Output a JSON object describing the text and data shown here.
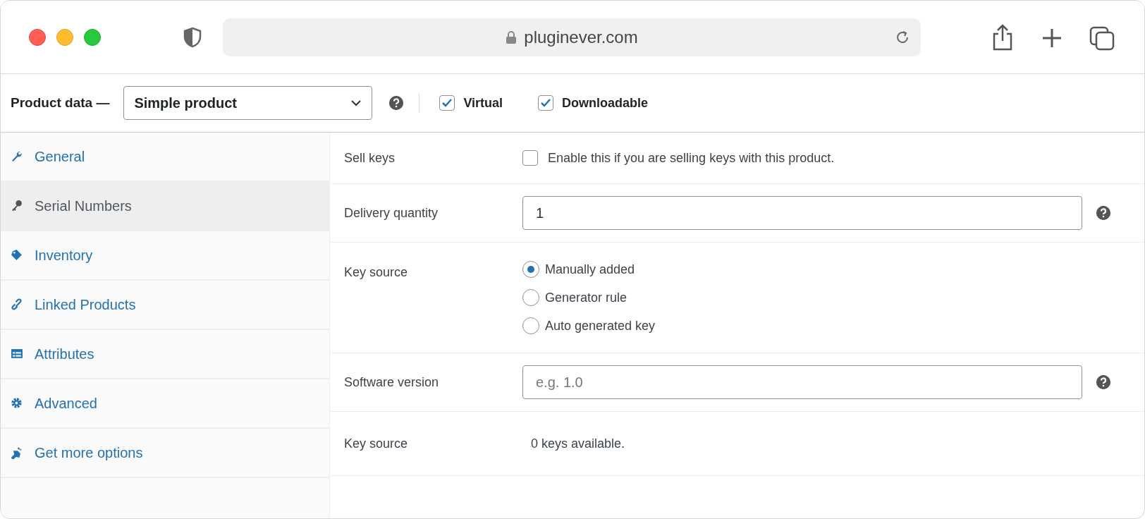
{
  "browser": {
    "url": "pluginever.com"
  },
  "product_data": {
    "label": "Product data —",
    "type_select": "Simple product",
    "options": [
      {
        "label": "Virtual",
        "checked": true
      },
      {
        "label": "Downloadable",
        "checked": true
      }
    ]
  },
  "sidebar": {
    "items": [
      {
        "label": "General",
        "kind": "wrench",
        "selected": false
      },
      {
        "label": "Serial Numbers",
        "kind": "key",
        "selected": true
      },
      {
        "label": "Inventory",
        "kind": "tag",
        "selected": false
      },
      {
        "label": "Linked Products",
        "kind": "link",
        "selected": false
      },
      {
        "label": "Attributes",
        "kind": "table",
        "selected": false
      },
      {
        "label": "Advanced",
        "kind": "gear",
        "selected": false
      },
      {
        "label": "Get more options",
        "kind": "plug",
        "selected": false
      }
    ]
  },
  "fields": [
    {
      "kind": "checkbox",
      "label": "Sell keys",
      "text": "Enable this if you are selling keys with this product.",
      "checked": false
    },
    {
      "kind": "input",
      "label": "Delivery quantity",
      "value": "1"
    },
    {
      "kind": "radio",
      "label": "Key source",
      "options": [
        {
          "label": "Manually added",
          "selected": true
        },
        {
          "label": "Generator rule",
          "selected": false
        },
        {
          "label": "Auto generated key",
          "selected": false
        }
      ]
    },
    {
      "kind": "input",
      "label": "Software version",
      "placeholder": "e.g. 1.0"
    },
    {
      "kind": "text",
      "label": "Key source",
      "text": "0 keys available."
    }
  ]
}
